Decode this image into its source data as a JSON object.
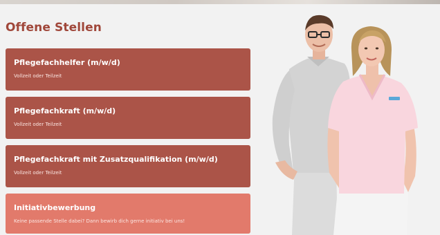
{
  "section": {
    "title": "Offene Stellen"
  },
  "jobs": [
    {
      "title": "Pflegefachhelfer (m/w/d)",
      "subtitle": "Vollzeit oder Teilzeit"
    },
    {
      "title": "Pflegefachkraft (m/w/d)",
      "subtitle": "Vollzeit oder Teilzeit"
    },
    {
      "title": "Pflegefachkraft mit Zusatzqualifikation (m/w/d)",
      "subtitle": "Vollzeit oder Teilzeit"
    },
    {
      "title": "Initiativbewerbung",
      "subtitle": "Keine passende Stelle dabei? Dann bewirb dich gerne initiativ bei uns!"
    }
  ],
  "colors": {
    "title": "#a0473a",
    "card": "#ab5448",
    "card_initiative": "#e27a6b",
    "background": "#f2f2f2"
  }
}
